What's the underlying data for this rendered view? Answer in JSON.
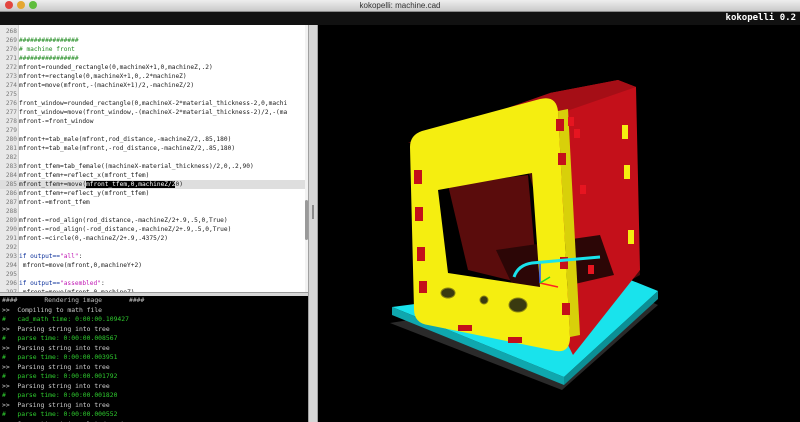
{
  "window": {
    "title": "kokopelli:  machine.cad"
  },
  "toolbar": {
    "app_name": "kokopelli 0.2"
  },
  "editor": {
    "lines": [
      {
        "n": "268",
        "text": ""
      },
      {
        "n": "269",
        "text": "################",
        "style": "cm"
      },
      {
        "n": "270",
        "text": "# machine front",
        "style": "cm"
      },
      {
        "n": "271",
        "text": "################",
        "style": "cm"
      },
      {
        "n": "272",
        "text": "mfront=rounded_rectangle(0,machineX+1,0,machineZ,.2)"
      },
      {
        "n": "273",
        "text": "mfront+=rectangle(0,machineX+1,0,.2*machineZ)"
      },
      {
        "n": "274",
        "text": "mfront=move(mfront,-(machineX+1)/2,-machineZ/2)"
      },
      {
        "n": "275",
        "text": ""
      },
      {
        "n": "276",
        "text": "front_window=rounded_rectangle(0,machineX-2*material_thickness-2,0,machi"
      },
      {
        "n": "277",
        "text": "front_window=move(front_window,-(machineX-2*material_thickness-2)/2,-(ma"
      },
      {
        "n": "278",
        "text": "mfront-=front_window"
      },
      {
        "n": "279",
        "text": ""
      },
      {
        "n": "280",
        "text": "mfront+=tab_male(mfront,rod_distance,-machineZ/2,.85,180)"
      },
      {
        "n": "281",
        "text": "mfront+=tab_male(mfront,-rod_distance,-machineZ/2,.85,180)"
      },
      {
        "n": "282",
        "text": ""
      },
      {
        "n": "283",
        "text": "mfront_tfem=tab_female((machineX-material_thickness)/2,0,.2,90)"
      },
      {
        "n": "284",
        "text": "mfront_tfem+=reflect_x(mfront_tfem)"
      },
      {
        "n": "285",
        "pre": "mfront_tfem+=move(",
        "selected": "mfront_tfem,0,machineZ/2",
        "cursor": "0",
        "post": ")",
        "current": true
      },
      {
        "n": "286",
        "text": "mfront_tfem+=reflect_y(mfront_tfem)"
      },
      {
        "n": "287",
        "text": "mfront-=mfront_tfem"
      },
      {
        "n": "288",
        "text": ""
      },
      {
        "n": "289",
        "text": "mfront-=rod_align(rod_distance,-machineZ/2+.9,.5,0,True)"
      },
      {
        "n": "290",
        "text": "mfront-=rod_align(-rod_distance,-machineZ/2+.9,.5,0,True)"
      },
      {
        "n": "291",
        "text": "mfront-=circle(0,-machineZ/2+.9,.4375/2)"
      },
      {
        "n": "292",
        "text": ""
      },
      {
        "n": "293",
        "pre": "if output==",
        "string": "\"all\"",
        "post": ":",
        "keyword_line": true
      },
      {
        "n": "294",
        "text": " mfront=move(mfront,0,machineY+2)"
      },
      {
        "n": "295",
        "text": ""
      },
      {
        "n": "296",
        "pre": "if output==",
        "string": "\"assembled\"",
        "post": ":",
        "keyword_line": true
      },
      {
        "n": "297",
        "text": " mfront=move(mfront,0,machineZ)"
      }
    ]
  },
  "console": {
    "lines": [
      {
        "text": "####       Rendering image       ####",
        "style": "hdr"
      },
      {
        "text": ">>  Compiling to math file",
        "style": ""
      },
      {
        "text": "#   cad_math time: 0:00:00.109427",
        "style": "ok"
      },
      {
        "text": ">>  Parsing string into tree",
        "style": ""
      },
      {
        "text": "#   parse time: 0:00:00.008567",
        "style": "ok"
      },
      {
        "text": ">>  Parsing string into tree",
        "style": ""
      },
      {
        "text": "#   parse time: 0:00:00.003951",
        "style": "ok"
      },
      {
        "text": ">>  Parsing string into tree",
        "style": ""
      },
      {
        "text": "#   parse time: 0:00:00.001792",
        "style": "ok"
      },
      {
        "text": ">>  Parsing string into tree",
        "style": ""
      },
      {
        "text": "#   parse time: 0:00:00.001820",
        "style": "ok"
      },
      {
        "text": ">>  Parsing string into tree",
        "style": ""
      },
      {
        "text": "#   parse time: 0:00:00.000552",
        "style": "ok"
      },
      {
        "text": ">>  Generating triangulated mesh",
        "style": ""
      }
    ]
  },
  "colors": {
    "model_face": "#f5ee10",
    "model_side": "#c4101a",
    "model_dark": "#4a0a0a",
    "model_base": "#19e3ec",
    "model_base_shadow": "#2a2a2a",
    "axis_x": "#ff2222",
    "axis_y": "#22dd22",
    "axis_z": "#2255ff"
  },
  "icons": {
    "close": "close-icon",
    "minimize": "minimize-icon",
    "maximize": "maximize-icon"
  }
}
